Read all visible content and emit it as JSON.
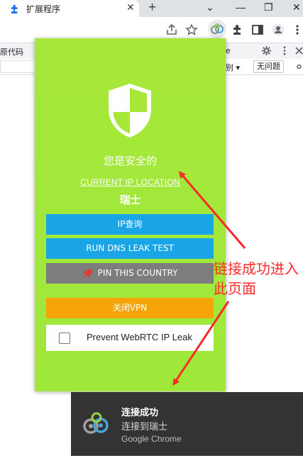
{
  "browser": {
    "tab_title": "扩展程序",
    "tab_close": "✕",
    "new_tab": "+",
    "minimize": "⌄",
    "restore": "—",
    "maximize": "❐",
    "close": "✕"
  },
  "devtools": {
    "left_text": "原代码",
    "e_text": "e",
    "filter_text": "别 ▾",
    "issues_button": "无问题"
  },
  "popup": {
    "status_text": "您是安全的",
    "location_label": "CURRENT IP LOCATION",
    "location_value": "瑞士",
    "buttons": {
      "ip_lookup": "IP查询",
      "dns_test": "RUN DNS LEAK TEST",
      "pin_country": "PIN THIS COUNTRY",
      "disconnect": "关闭VPN"
    },
    "webrtc_label": "Prevent WebRTC IP Leak",
    "colors": {
      "background": "#a6e83a",
      "button_blue": "#1aa6e6",
      "button_gray": "#7d7d7d",
      "button_orange": "#f5a40a"
    }
  },
  "annotation": {
    "text_line1": "链接成功进入",
    "text_line2": "此页面",
    "color": "#ff2a2a"
  },
  "notification": {
    "title": "连接成功",
    "body": "连接到瑞士",
    "source": "Google Chrome"
  }
}
